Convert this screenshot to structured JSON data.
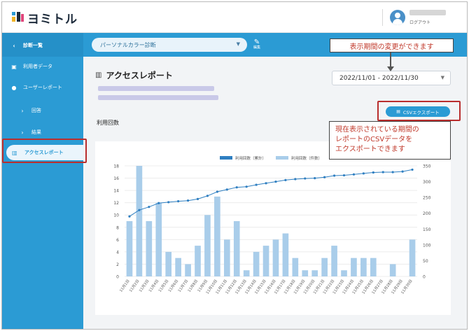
{
  "header": {
    "logo_text": "ヨミトル",
    "logout_label": "ログアウト"
  },
  "sidebar": {
    "back_label": "診断一覧",
    "usage_data_label": "利用者データ",
    "user_report_label": "ユーザーレポート",
    "answer_label": "回答",
    "result_label": "結果",
    "access_report_label": "アクセスレポート"
  },
  "topbar": {
    "diagnosis_select": "パーソナルカラー診断",
    "edit_label": "編集"
  },
  "main": {
    "title": "アクセスレポート",
    "date_range": "2022/11/01 - 2022/11/30",
    "csv_button": "CSVエクスポート",
    "usage_count_label": "利用回数"
  },
  "callouts": {
    "period_change": "表示期間の変更ができます",
    "csv_line1": "現在表示されている期間の",
    "csv_line2": "レポートのCSVデータを",
    "csv_line3": "エクスポートできます"
  },
  "chart_data": {
    "type": "bar",
    "categories": [
      "11月1日",
      "11月2日",
      "11月3日",
      "11月4日",
      "11月5日",
      "11月6日",
      "11月7日",
      "11月8日",
      "11月9日",
      "11月10日",
      "11月11日",
      "11月12日",
      "11月13日",
      "11月14日",
      "11月15日",
      "11月16日",
      "11月17日",
      "11月18日",
      "11月19日",
      "11月20日",
      "11月21日",
      "11月22日",
      "11月23日",
      "11月24日",
      "11月25日",
      "11月26日",
      "11月27日",
      "11月28日",
      "11月29日",
      "11月30日"
    ],
    "series": [
      {
        "name": "利用回数（累計）",
        "kind": "line",
        "axis": "right",
        "color": "#2f7fc1",
        "values": [
          190,
          210,
          220,
          232,
          235,
          238,
          240,
          245,
          255,
          268,
          275,
          282,
          284,
          290,
          295,
          300,
          305,
          308,
          310,
          311,
          314,
          319,
          320,
          323,
          326,
          329,
          330,
          330,
          332,
          338
        ]
      },
      {
        "name": "利用回数（件数）",
        "kind": "bar",
        "axis": "left",
        "color": "#a9cdea",
        "values": [
          9,
          18,
          9,
          12,
          4,
          3,
          2,
          5,
          10,
          13,
          6,
          9,
          1,
          4,
          5,
          6,
          7,
          3,
          1,
          1,
          3,
          5,
          1,
          3,
          3,
          3,
          0,
          2,
          0,
          6
        ]
      }
    ],
    "y_left": {
      "min": 0,
      "max": 18,
      "ticks": [
        0,
        2,
        4,
        6,
        8,
        10,
        12,
        14,
        16,
        18
      ]
    },
    "y_right": {
      "min": 0,
      "max": 350,
      "ticks": [
        0,
        50,
        100,
        150,
        200,
        250,
        300,
        350
      ]
    },
    "legend": "top-center",
    "grid": true
  }
}
